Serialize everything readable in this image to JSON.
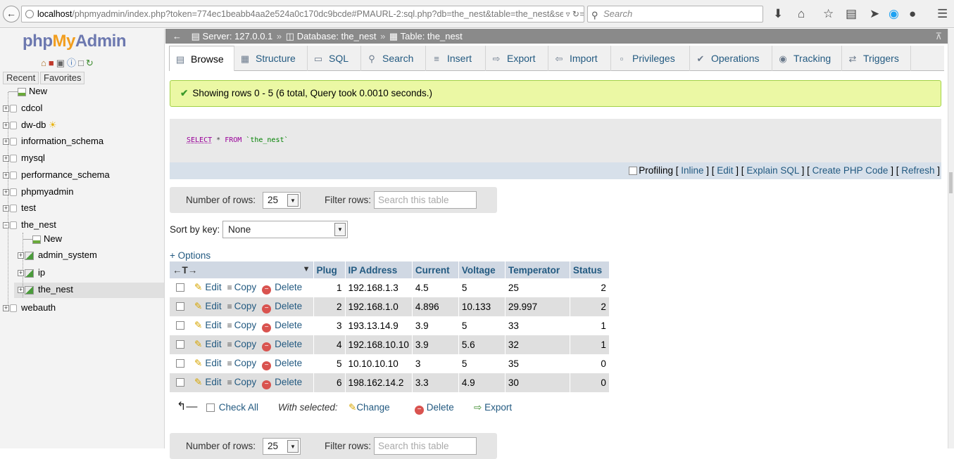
{
  "browser": {
    "url_host": "localhost",
    "url_rest": "/phpmyadmin/index.php?token=774ec1beabb4aa2e524a0c170dc9bcde#PMAURL-2:sql.php?db=the_nest&table=the_nest&server=",
    "search_placeholder": "Search"
  },
  "sidebar": {
    "logo": {
      "php": "php",
      "my": "My",
      "admin": "Admin"
    },
    "tabs": {
      "recent": "Recent",
      "favorites": "Favorites"
    },
    "tree": {
      "new": "New",
      "cdcol": "cdcol",
      "dwdb": "dw-db",
      "information_schema": "information_schema",
      "mysql": "mysql",
      "performance_schema": "performance_schema",
      "phpmyadmin": "phpmyadmin",
      "test": "test",
      "the_nest": "the_nest",
      "the_nest_new": "New",
      "admin_system": "admin_system",
      "ip": "ip",
      "the_nest_table": "the_nest",
      "webauth": "webauth"
    }
  },
  "breadcrumb": {
    "server": "Server: 127.0.0.1",
    "database": "Database: the_nest",
    "table": "Table: the_nest",
    "sep": "»"
  },
  "tabs": [
    {
      "label": "Browse"
    },
    {
      "label": "Structure"
    },
    {
      "label": "SQL"
    },
    {
      "label": "Search"
    },
    {
      "label": "Insert"
    },
    {
      "label": "Export"
    },
    {
      "label": "Import"
    },
    {
      "label": "Privileges"
    },
    {
      "label": "Operations"
    },
    {
      "label": "Tracking"
    },
    {
      "label": "Triggers"
    }
  ],
  "message": "Showing rows 0 - 5 (6 total, Query took 0.0010 seconds.)",
  "sql": {
    "select": "SELECT",
    "star": " * ",
    "from": "FROM",
    "table": " `the_nest`"
  },
  "sql_links": {
    "profiling": "Profiling",
    "inline": "Inline",
    "edit": "Edit",
    "explain": "Explain SQL",
    "php": "Create PHP Code",
    "refresh": "Refresh"
  },
  "nav": {
    "rows_label": "Number of rows:",
    "rows_value": "25",
    "filter_label": "Filter rows:",
    "filter_placeholder": "Search this table"
  },
  "sort": {
    "label": "Sort by key:",
    "value": "None"
  },
  "options": "+ Options",
  "table": {
    "arrows": "←T→",
    "headers": {
      "plug": "Plug",
      "ip": "IP Address",
      "current": "Current",
      "voltage": "Voltage",
      "temp": "Temperator",
      "status": "Status"
    },
    "actions": {
      "edit": "Edit",
      "copy": "Copy",
      "delete": "Delete"
    },
    "rows": [
      {
        "plug": "1",
        "ip": "192.168.1.3",
        "current": "4.5",
        "voltage": "5",
        "temp": "25",
        "status": "2"
      },
      {
        "plug": "2",
        "ip": "192.168.1.0",
        "current": "4.896",
        "voltage": "10.133",
        "temp": "29.997",
        "status": "2"
      },
      {
        "plug": "3",
        "ip": "193.13.14.9",
        "current": "3.9",
        "voltage": "5",
        "temp": "33",
        "status": "1"
      },
      {
        "plug": "4",
        "ip": "192.168.10.10",
        "current": "3.9",
        "voltage": "5.6",
        "temp": "32",
        "status": "1"
      },
      {
        "plug": "5",
        "ip": "10.10.10.10",
        "current": "3",
        "voltage": "5",
        "temp": "35",
        "status": "0"
      },
      {
        "plug": "6",
        "ip": "198.162.14.2",
        "current": "3.3",
        "voltage": "4.9",
        "temp": "30",
        "status": "0"
      }
    ]
  },
  "bulk": {
    "check_all": "Check All",
    "with_selected": "With selected:",
    "change": "Change",
    "delete": "Delete",
    "export": "Export"
  }
}
